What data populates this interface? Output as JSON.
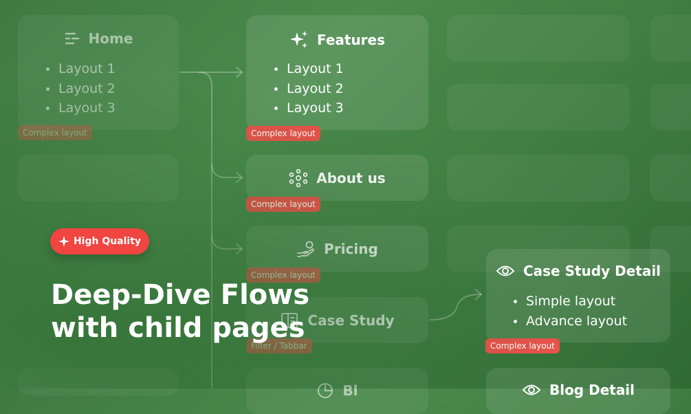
{
  "nodes": {
    "home": {
      "title": "Home",
      "items": [
        "Layout 1",
        "Layout 2",
        "Layout 3"
      ],
      "badge": "Complex layout"
    },
    "features": {
      "title": "Features",
      "items": [
        "Layout 1",
        "Layout 2",
        "Layout 3"
      ],
      "badge": "Complex layout"
    },
    "about": {
      "title": "About us",
      "badge": "Complex layout"
    },
    "pricing": {
      "title": "Pricing",
      "badge": "Complex layout"
    },
    "case_study": {
      "title": "Case Study",
      "badge": "Filter / Tabbar"
    },
    "blog": {
      "title": "Bl"
    },
    "case_detail": {
      "title": "Case Study Detail",
      "items": [
        "Simple layout",
        "Advance layout"
      ],
      "badge": "Complex layout"
    },
    "blog_detail": {
      "title": "Blog Detail"
    }
  },
  "promo": {
    "pill_label": "High Quality",
    "headline_line1": "Deep-Dive Flows",
    "headline_line2": "with child pages"
  },
  "colors": {
    "background": "#437f45",
    "badge": "#e8524a",
    "pill": "#f04540"
  },
  "icons": [
    "menu-lines-icon",
    "sparkle-icon",
    "network-icon",
    "hand-coin-icon",
    "layout-list-icon",
    "eye-icon",
    "star-icon"
  ]
}
